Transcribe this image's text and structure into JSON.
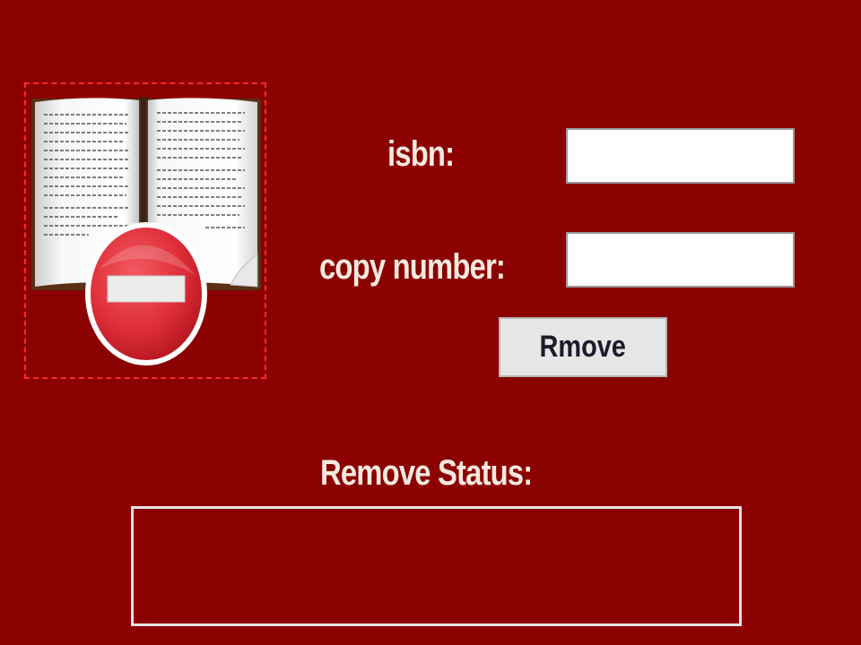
{
  "form": {
    "isbn_label": "isbn:",
    "isbn_value": "",
    "copy_number_label": "copy number:",
    "copy_number_value": "",
    "remove_button_label": "Rmove",
    "status_label": "Remove Status:",
    "status_text": ""
  },
  "icons": {
    "main": "book-remove-icon"
  },
  "colors": {
    "background": "#8b0000",
    "label_text": "#f4eadf",
    "button_bg": "#e6e6e6",
    "icon_frame_border": "#ff2a2a",
    "remove_sign_red": "#e23a44"
  }
}
